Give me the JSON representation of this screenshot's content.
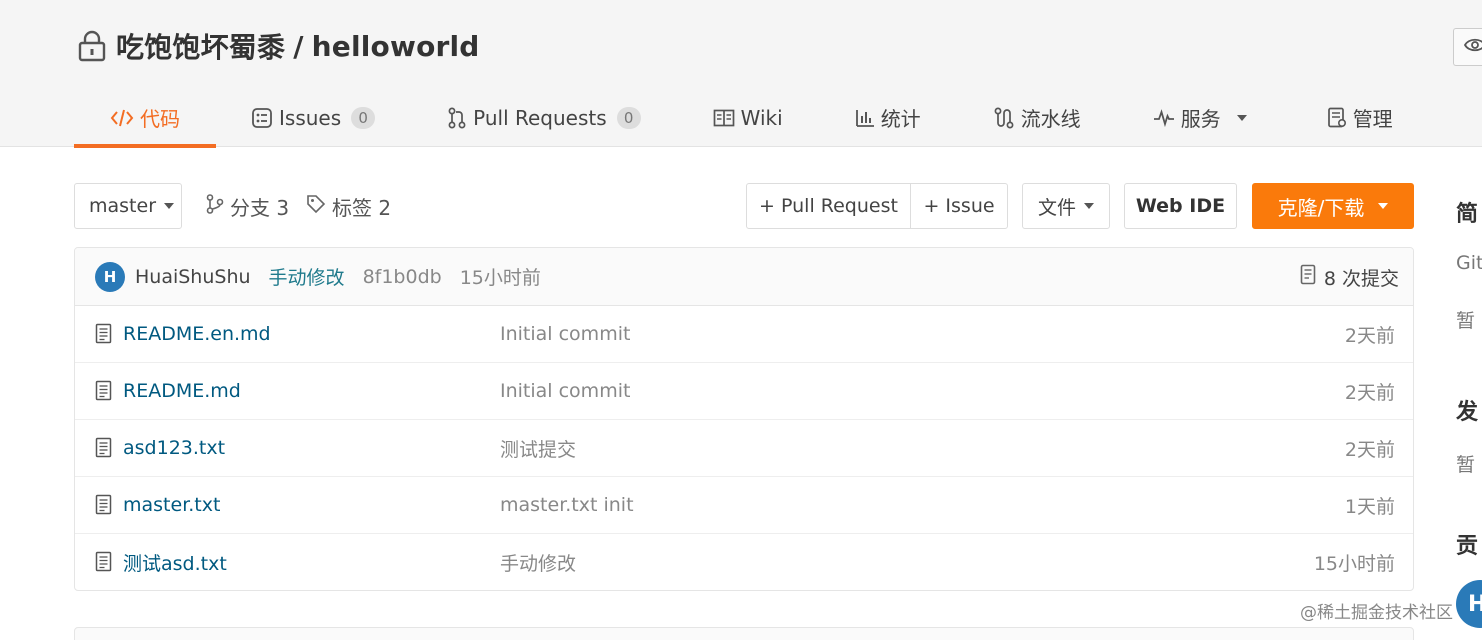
{
  "repo": {
    "owner": "吃饱饱坏蜀黍",
    "separator": " / ",
    "name": "helloworld"
  },
  "tabs": [
    {
      "label": "代码",
      "icon": "code-icon",
      "active": true
    },
    {
      "label": "Issues",
      "icon": "issues-icon",
      "badge": "0"
    },
    {
      "label": "Pull Requests",
      "icon": "pull-request-icon",
      "badge": "0"
    },
    {
      "label": "Wiki",
      "icon": "wiki-icon"
    },
    {
      "label": "统计",
      "icon": "stats-icon"
    },
    {
      "label": "流水线",
      "icon": "pipeline-icon"
    },
    {
      "label": "服务",
      "icon": "pulse-icon"
    },
    {
      "label": "管理",
      "icon": "manage-icon"
    }
  ],
  "toolbar": {
    "branch": "master",
    "branches_label": "分支 3",
    "tags_label": "标签 2",
    "pr_button": "+ Pull Request",
    "issue_button": "+ Issue",
    "file_button": "文件",
    "webide_button": "Web IDE",
    "clone_button": "克隆/下载"
  },
  "commit": {
    "avatar_letter": "H",
    "author": "HuaiShuShu",
    "message": "手动修改",
    "sha": "8f1b0db",
    "time": "15小时前",
    "count_label": "8 次提交"
  },
  "files": [
    {
      "name": "README.en.md",
      "message": "Initial commit",
      "time": "2天前"
    },
    {
      "name": "README.md",
      "message": "Initial commit",
      "time": "2天前"
    },
    {
      "name": "asd123.txt",
      "message": "测试提交",
      "time": "2天前"
    },
    {
      "name": "master.txt",
      "message": "master.txt init",
      "time": "1天前"
    },
    {
      "name": "测试asd.txt",
      "message": "手动修改",
      "time": "15小时前"
    }
  ],
  "sidebar": {
    "intro_heading": "简",
    "intro_text": "Git",
    "intro_empty": "暂",
    "release_heading": "发",
    "release_empty": "暂",
    "contributors_heading": "贡",
    "avatar_letter": "H"
  },
  "watermark": "@稀土掘金技术社区",
  "colors": {
    "accent": "#f36d23",
    "clone": "#fa7a0b",
    "link": "#005980",
    "commit_msg": "#1f7a8c"
  }
}
